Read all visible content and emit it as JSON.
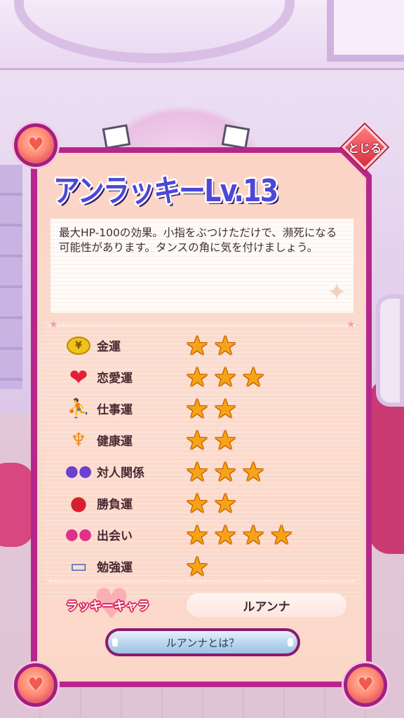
{
  "dialog": {
    "title": "アンラッキーLv.13",
    "close_label": "とじる",
    "description": "最大HP-100の効果。小指をぶつけただけで、瀕死になる可能性があります。タンスの角に気を付けましょう。"
  },
  "fortunes": [
    {
      "label": "金運",
      "icon": "coin-purse-icon",
      "stars": 2
    },
    {
      "label": "恋愛運",
      "icon": "heart-icon",
      "stars": 3
    },
    {
      "label": "仕事運",
      "icon": "worker-icon",
      "stars": 2
    },
    {
      "label": "健康運",
      "icon": "strong-arm-icon",
      "stars": 2
    },
    {
      "label": "対人関係",
      "icon": "people-icon",
      "stars": 3
    },
    {
      "label": "勝負運",
      "icon": "boxing-glove-icon",
      "stars": 2
    },
    {
      "label": "出会い",
      "icon": "couple-icon",
      "stars": 4
    },
    {
      "label": "勉強運",
      "icon": "book-icon",
      "stars": 1
    }
  ],
  "lucky_chara": {
    "label": "ラッキーキャラ",
    "value": "ルアンナ"
  },
  "about_button": {
    "label": "ルアンナとは？"
  },
  "coin_symbol": "¥",
  "colors": {
    "frame": "#b7278b",
    "panel": "#fbd3c4",
    "title": "#4d47d9",
    "star": "#f6a417",
    "close_button": "#d82d3f"
  }
}
